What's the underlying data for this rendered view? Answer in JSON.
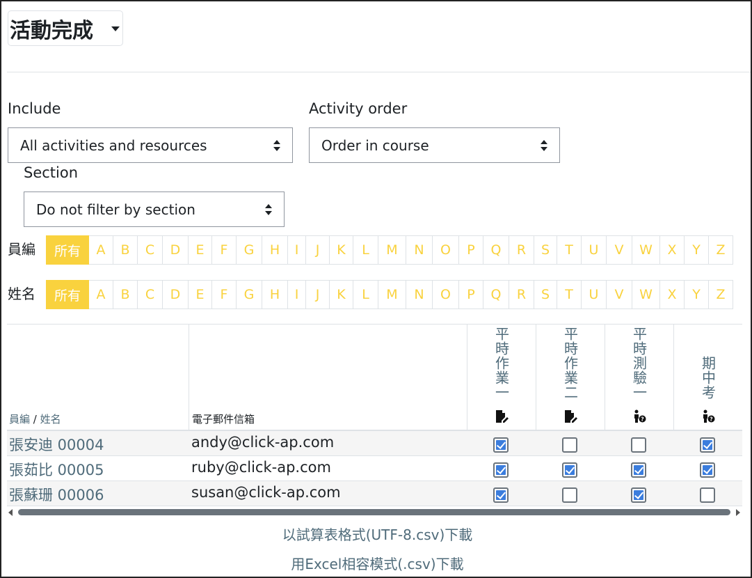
{
  "page": {
    "title": "活動完成"
  },
  "filters": {
    "include": {
      "label": "Include",
      "value": "All activities and resources"
    },
    "activity_order": {
      "label": "Activity order",
      "value": "Order in course"
    },
    "section": {
      "label": "Section",
      "value": "Do not filter by section"
    }
  },
  "initials": {
    "idnumber_label": "員編",
    "name_label": "姓名",
    "all_label": "所有",
    "letters": [
      "A",
      "B",
      "C",
      "D",
      "E",
      "F",
      "G",
      "H",
      "I",
      "J",
      "K",
      "L",
      "M",
      "N",
      "O",
      "P",
      "Q",
      "R",
      "S",
      "T",
      "U",
      "V",
      "W",
      "X",
      "Y",
      "Z"
    ]
  },
  "table": {
    "header_idnumber": "員編",
    "header_sep": " / ",
    "header_name": "姓名",
    "header_email": "電子郵件信箱",
    "activities": [
      {
        "name": "平時作業一",
        "icon": "assignment-icon"
      },
      {
        "name": "平時作業二",
        "icon": "assignment-icon"
      },
      {
        "name": "平時測驗一",
        "icon": "quiz-icon"
      },
      {
        "name": "期中考",
        "icon": "quiz-icon"
      }
    ],
    "rows": [
      {
        "user": "張安迪 00004",
        "email": "andy@click-ap.com",
        "completion": [
          true,
          false,
          false,
          true
        ]
      },
      {
        "user": "張茹比 00005",
        "email": "ruby@click-ap.com",
        "completion": [
          true,
          true,
          true,
          true
        ]
      },
      {
        "user": "張蘇珊 00006",
        "email": "susan@click-ap.com",
        "completion": [
          true,
          false,
          true,
          false
        ]
      }
    ]
  },
  "downloads": {
    "spreadsheet": "以試算表格式(UTF-8.csv)下載",
    "excel": "用Excel相容模式(.csv)下載"
  },
  "colors": {
    "accent": "#f9d23e",
    "link": "#4f6b7a",
    "check": "#3b7ddd"
  }
}
